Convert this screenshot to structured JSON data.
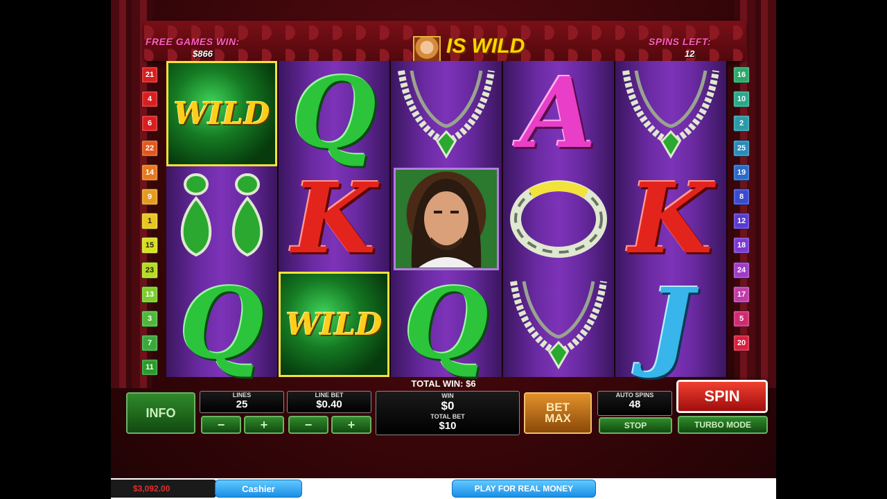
{
  "header": {
    "free_games_label": "FREE GAMES WIN:",
    "free_games_value": "$866",
    "is_wild_text": "IS WILD",
    "spins_left_label": "SPINS LEFT:",
    "spins_left_value": "12"
  },
  "paylines_left": [
    "21",
    "4",
    "6",
    "22",
    "14",
    "9",
    "1",
    "15",
    "23",
    "13",
    "3",
    "7",
    "11"
  ],
  "paylines_right": [
    "16",
    "10",
    "2",
    "25",
    "19",
    "8",
    "12",
    "18",
    "24",
    "17",
    "5",
    "20"
  ],
  "reels": [
    [
      "WILD",
      "earrings",
      "Q"
    ],
    [
      "Q",
      "K",
      "WILD"
    ],
    [
      "necklace",
      "man",
      "Q"
    ],
    [
      "A",
      "bracelet",
      "necklace"
    ],
    [
      "necklace",
      "K",
      "J"
    ]
  ],
  "wild_label": "WILD",
  "total_win_text": "TOTAL WIN: $6",
  "controls": {
    "info": "INFO",
    "lines_label": "LINES",
    "lines_value": "25",
    "line_bet_label": "LINE BET",
    "line_bet_value": "$0.40",
    "minus": "−",
    "plus": "+",
    "win_label": "WIN",
    "win_value": "$0",
    "total_bet_label": "TOTAL BET",
    "total_bet_value": "$10",
    "bet_max": "BET MAX",
    "auto_spins_label": "AUTO SPINS",
    "auto_spins_value": "48",
    "stop": "STOP",
    "spin": "SPIN",
    "turbo_mode": "TURBO MODE"
  },
  "bottom": {
    "balance": "$3,092.00",
    "cashier": "Cashier",
    "play_real": "PLAY FOR REAL MONEY"
  },
  "colors": {
    "accent_red": "#d81e1e",
    "accent_green": "#2f8a2a",
    "reel_purple": "#7d33b8",
    "wild_yellow": "#ffce1a"
  }
}
